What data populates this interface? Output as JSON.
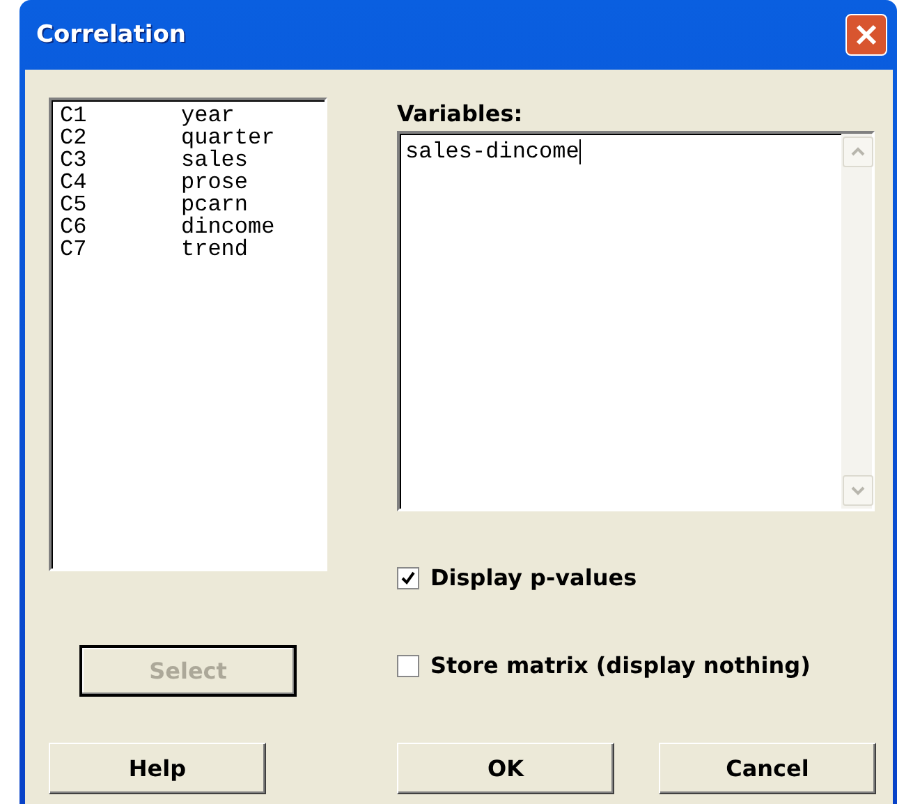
{
  "window": {
    "title": "Correlation"
  },
  "columns_list": [
    {
      "id": "C1",
      "name": "year"
    },
    {
      "id": "C2",
      "name": "quarter"
    },
    {
      "id": "C3",
      "name": "sales"
    },
    {
      "id": "C4",
      "name": "prose"
    },
    {
      "id": "C5",
      "name": "pcarn"
    },
    {
      "id": "C6",
      "name": "dincome"
    },
    {
      "id": "C7",
      "name": "trend"
    }
  ],
  "variables": {
    "label": "Variables:",
    "value": "sales-dincome"
  },
  "options": [
    {
      "label": "Display p-values",
      "checked": true
    },
    {
      "label": "Store matrix (display nothing)",
      "checked": false
    }
  ],
  "select_button": {
    "label": "Select",
    "disabled": true
  },
  "buttons": [
    "Help",
    "OK",
    "Cancel"
  ]
}
